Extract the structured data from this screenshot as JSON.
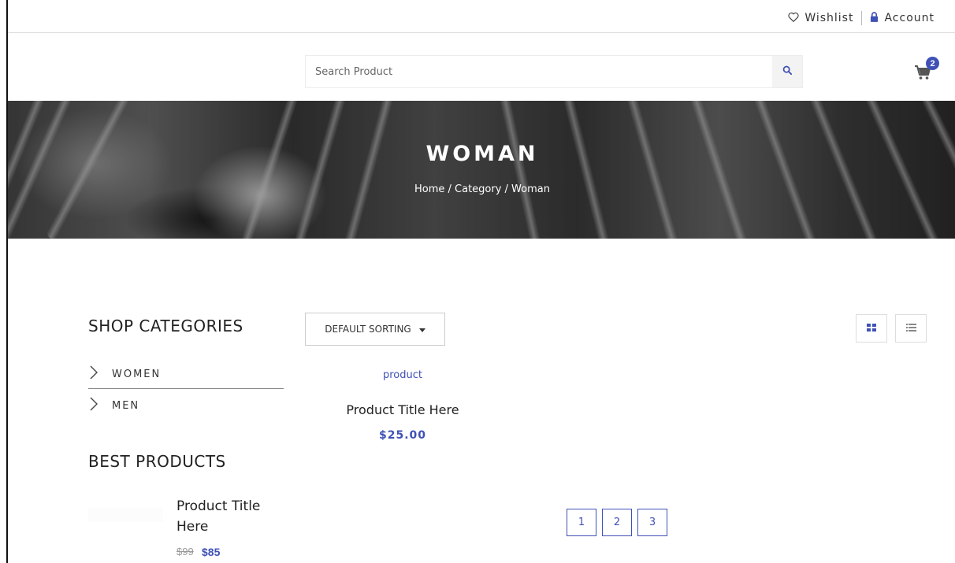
{
  "topbar": {
    "wishlist_label": "Wishlist",
    "wishlist_icon": "heart-outline-icon",
    "account_label": "Account",
    "account_icon": "lock-icon"
  },
  "header": {
    "search_placeholder": "Search Product",
    "search_icon": "search-icon",
    "cart_icon": "cart-icon",
    "cart_count": "2"
  },
  "hero": {
    "title": "WOMAN",
    "breadcrumb": "Home / Category / Woman"
  },
  "sidebar": {
    "categories_heading": "SHOP CATEGORIES",
    "categories": [
      {
        "label": "WOMEN"
      },
      {
        "label": "MEN"
      }
    ],
    "best_heading": "BEST PRODUCTS",
    "best_products": [
      {
        "title": "Product Title Here",
        "old_price": "$99",
        "price": "$85"
      }
    ]
  },
  "toolbar": {
    "sort_label": "DEFAULT SORTING",
    "grid_view_icon": "grid-view-icon",
    "list_view_icon": "list-view-icon"
  },
  "products": [
    {
      "category": "product",
      "title": "Product Title Here",
      "price": "$25.00"
    }
  ],
  "pagination": {
    "pages": [
      "1",
      "2",
      "3"
    ]
  },
  "colors": {
    "accent": "#3f51b5"
  }
}
